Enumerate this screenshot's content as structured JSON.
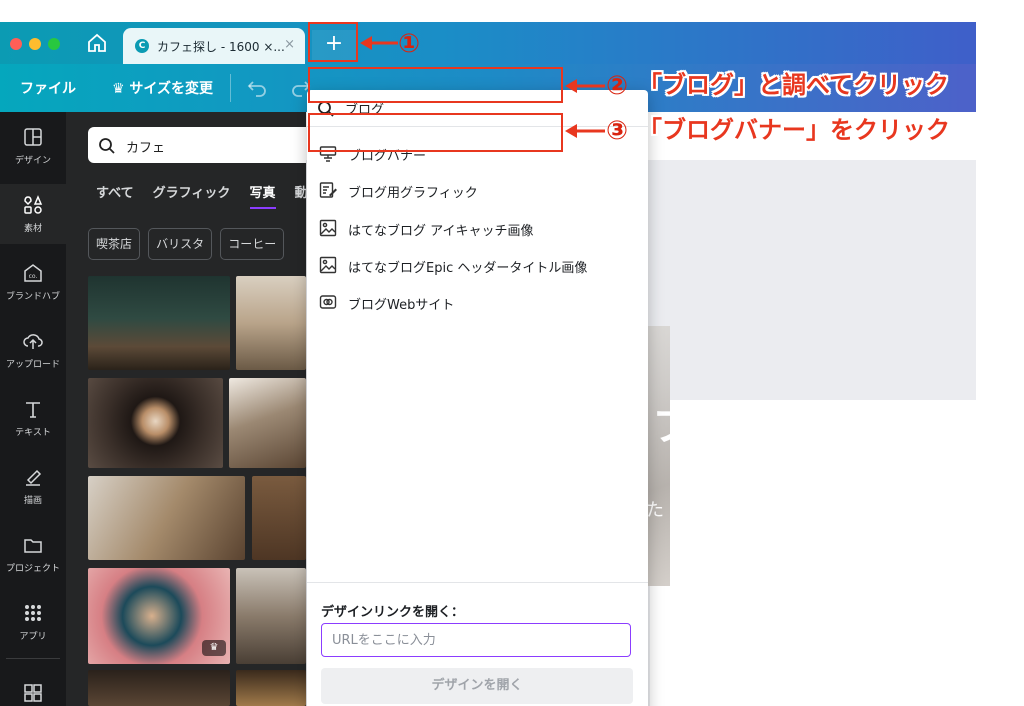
{
  "window": {
    "tab_title": "カフェ探し - 1600 ×...",
    "tab_close": "×",
    "new_tab": "+"
  },
  "header": {
    "file_menu": "ファイル",
    "resize_button": "♛ サイズを変更"
  },
  "sidebar": {
    "items": [
      {
        "label": "デザイン",
        "icon": "layout-icon"
      },
      {
        "label": "素材",
        "icon": "elements-icon"
      },
      {
        "label": "ブランドハブ",
        "icon": "brand-hub-icon"
      },
      {
        "label": "アップロード",
        "icon": "upload-icon"
      },
      {
        "label": "テキスト",
        "icon": "text-icon"
      },
      {
        "label": "描画",
        "icon": "draw-icon"
      },
      {
        "label": "プロジェクト",
        "icon": "folder-icon"
      },
      {
        "label": "アプリ",
        "icon": "apps-icon"
      }
    ]
  },
  "panel": {
    "search_value": "カフェ",
    "filters": [
      "すべて",
      "グラフィック",
      "写真",
      "動画"
    ],
    "active_filter": "写真",
    "chips": [
      "喫茶店",
      "バリスタ",
      "コーヒー"
    ],
    "premium_badge": "♛"
  },
  "dropdown": {
    "search_value": "ブログ",
    "results": [
      {
        "label": "ブログバナー",
        "icon": "banner-icon"
      },
      {
        "label": "ブログ用グラフィック",
        "icon": "graphic-edit-icon"
      },
      {
        "label": "はてなブログ アイキャッチ画像",
        "icon": "image-icon"
      },
      {
        "label": "はてなブログEpic ヘッダータイトル画像",
        "icon": "image-icon"
      },
      {
        "label": "ブログWebサイト",
        "icon": "website-icon"
      }
    ],
    "open_link_title": "デザインリンクを開く：",
    "url_placeholder": "URLをここに入力",
    "open_button": "デザインを開く"
  },
  "canvas": {
    "title_partial": "カフ",
    "subtitle_partial": "あなた"
  },
  "annotations": {
    "step1": "①",
    "step2": "②",
    "step2_text": "「ブログ」と調べてクリック",
    "step3": "③",
    "step3_text": "「ブログバナー」をクリック"
  },
  "colors": {
    "annotation_red": "#e8371f",
    "accent_purple": "#8b3dff",
    "toolbar_teal": "#0b9bb3"
  }
}
